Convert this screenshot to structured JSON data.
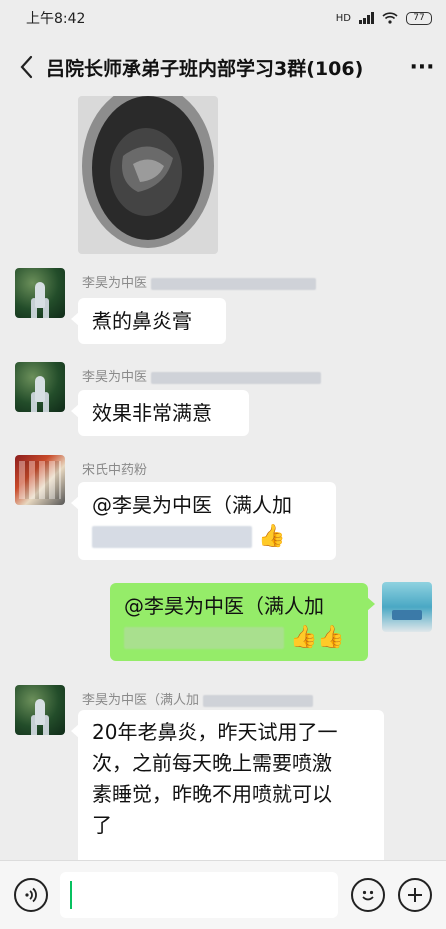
{
  "status_bar": {
    "time": "上午8:42",
    "network": "HD",
    "battery": "77"
  },
  "header": {
    "title": "吕院长师承弟子班内部学习3群(106)",
    "more": "···"
  },
  "messages": [
    {
      "sender": "李昊为中医",
      "text": "煮的鼻炎膏"
    },
    {
      "sender": "李昊为中医",
      "text": "效果非常满意"
    },
    {
      "sender": "宋氏中药粉",
      "text": "@李昊为中医（满人加",
      "emoji": "👍"
    },
    {
      "text": "@李昊为中医（满人加",
      "emoji": "👍👍"
    },
    {
      "sender": "李昊为中医（满人加",
      "lines": [
        "20年老鼻炎，昨天试用了一",
        "次，之前每天晚上需要喷激",
        "素睡觉，昨晚不用喷就可以",
        "了"
      ]
    }
  ],
  "colors": {
    "background": "#ededed",
    "outgoing_bubble": "#95ec69",
    "incoming_bubble": "#ffffff",
    "caret": "#07c160"
  }
}
